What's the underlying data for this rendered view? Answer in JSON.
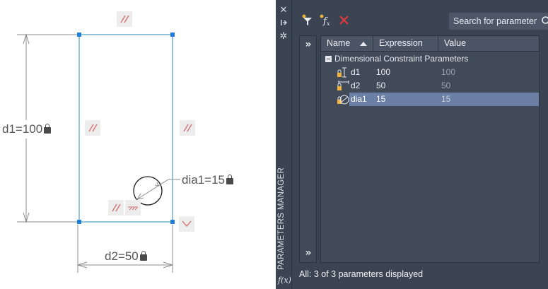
{
  "drawing": {
    "dim_d1": "d1=100",
    "dim_d2": "d2=50",
    "dim_dia1": "dia1=15"
  },
  "palette": {
    "title": "PARAMETERS MANAGER",
    "fx_label": "f(x)",
    "search": {
      "placeholder": "Search for parameter",
      "value": ""
    },
    "columns": {
      "name": "Name",
      "expression": "Expression",
      "value": "Value"
    },
    "group": {
      "label": "Dimensional Constraint Parameters"
    },
    "rows": [
      {
        "name": "d1",
        "expression": "100",
        "value": "100",
        "icon": "vertical-dimension-lock-icon",
        "selected": false
      },
      {
        "name": "d2",
        "expression": "50",
        "value": "50",
        "icon": "horizontal-dimension-lock-icon",
        "selected": false
      },
      {
        "name": "dia1",
        "expression": "15",
        "value": "15",
        "icon": "diameter-dimension-lock-icon",
        "selected": true
      }
    ],
    "status": "All: 3 of 3 parameters displayed",
    "colors": {
      "panel_bg": "#3b4453",
      "selection": "#6b7ea3",
      "delete_red": "#e03a3a",
      "geometry": "#2a8ab3"
    }
  }
}
